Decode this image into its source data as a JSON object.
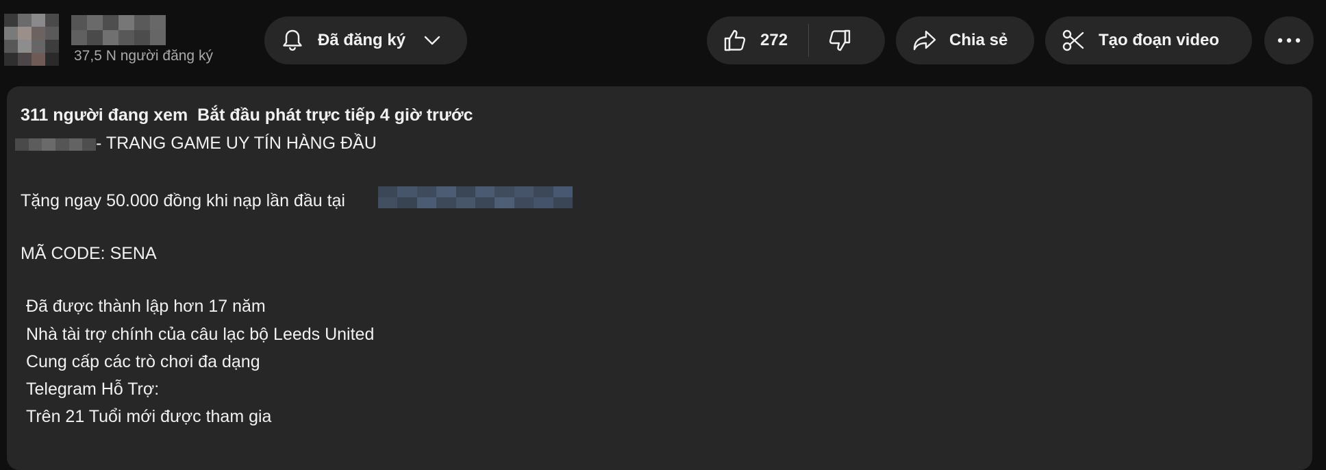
{
  "channel": {
    "subscribers": "37,5 N người đăng ký"
  },
  "actions": {
    "subscribe_label": "Đã đăng ký",
    "like_count": "272",
    "share_label": "Chia sẻ",
    "clip_label": "Tạo đoạn video"
  },
  "icons": {
    "subscribe": "bell-icon",
    "subscribe_menu": "chevron-down-icon",
    "like": "thumbs-up-icon",
    "dislike": "thumbs-down-icon",
    "share": "share-arrow-icon",
    "clip": "scissors-icon",
    "more": "more-horizontal-icon"
  },
  "description": {
    "meta": "311 người đang xem  Bắt đầu phát trực tiếp 4 giờ trước",
    "line_1": "- TRANG GAME UY TÍN HÀNG ĐẦU",
    "line_2": "Tặng ngay 50.000 đồng khi nạp lần đầu tại",
    "line_3": "MÃ CODE: SENA",
    "line_4": "Đã được thành lập hơn 17 năm",
    "line_5": "Nhà tài trợ chính của câu lạc bộ Leeds United",
    "line_6": "Cung cấp các trò chơi đa dạng",
    "line_7": "Telegram Hỗ Trợ:",
    "line_8": "Trên 21 Tuổi mới được tham gia"
  },
  "colors": {
    "background": "#0f0f0f",
    "surface": "#272727",
    "text": "#f1f1f1",
    "muted": "#aaaaaa"
  }
}
